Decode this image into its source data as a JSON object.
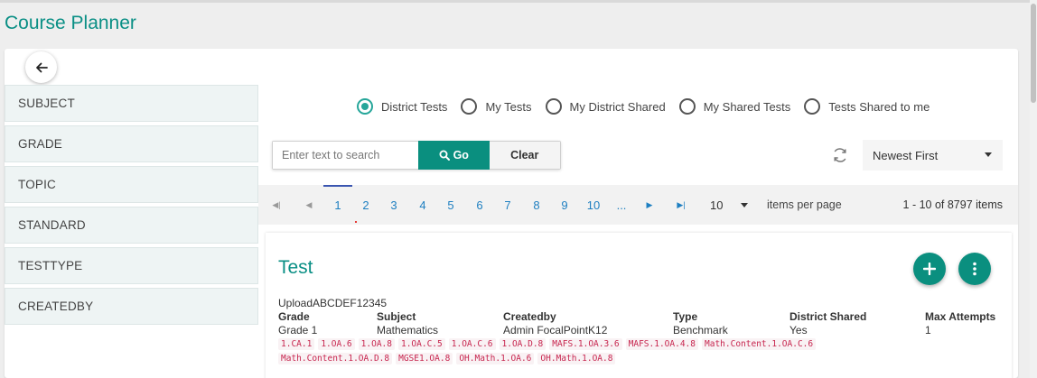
{
  "page_title": "Course Planner",
  "sidebar": {
    "items": [
      {
        "label": "SUBJECT"
      },
      {
        "label": "GRADE"
      },
      {
        "label": "TOPIC"
      },
      {
        "label": "STANDARD"
      },
      {
        "label": "TESTTYPE"
      },
      {
        "label": "CREATEDBY"
      }
    ]
  },
  "filters": {
    "options": [
      {
        "label": "District Tests",
        "selected": true
      },
      {
        "label": "My Tests",
        "selected": false
      },
      {
        "label": "My District Shared",
        "selected": false
      },
      {
        "label": "My Shared Tests",
        "selected": false
      },
      {
        "label": "Tests Shared to me",
        "selected": false
      }
    ]
  },
  "search": {
    "placeholder": "Enter text to search",
    "value": "",
    "go_label": "Go",
    "clear_label": "Clear"
  },
  "sort": {
    "selected": "Newest First"
  },
  "pagination": {
    "pages": [
      "1",
      "2",
      "3",
      "4",
      "5",
      "6",
      "7",
      "8",
      "9",
      "10",
      "..."
    ],
    "current_page": "1",
    "page_size": "10",
    "items_per_page_label": "items per page",
    "range_text": "1 - 10 of 8797 items"
  },
  "test": {
    "title": "Test",
    "name": "UploadABCDEF12345",
    "fields": [
      {
        "label": "Grade",
        "value": "Grade 1"
      },
      {
        "label": "Subject",
        "value": "Mathematics"
      },
      {
        "label": "Createdby",
        "value": "Admin FocalPointK12"
      },
      {
        "label": "Type",
        "value": "Benchmark"
      },
      {
        "label": "District Shared",
        "value": "Yes"
      },
      {
        "label": "Max Attempts",
        "value": "1"
      }
    ],
    "standards": [
      "1.CA.1",
      "1.OA.6",
      "1.OA.8",
      "1.OA.C.5",
      "1.OA.C.6",
      "1.OA.D.8",
      "MAFS.1.OA.3.6",
      "MAFS.1.OA.4.8",
      "Math.Content.1.OA.C.6",
      "Math.Content.1.OA.D.8",
      "MGSE1.OA.8",
      "OH.Math.1.OA.6",
      "OH.Math.1.OA.8"
    ]
  },
  "colors": {
    "accent": "#0a8f85",
    "button": "#0a8f7f",
    "radio_selected": "#26a69a",
    "link": "#1e7fc1",
    "tag_text": "#c7254e"
  }
}
